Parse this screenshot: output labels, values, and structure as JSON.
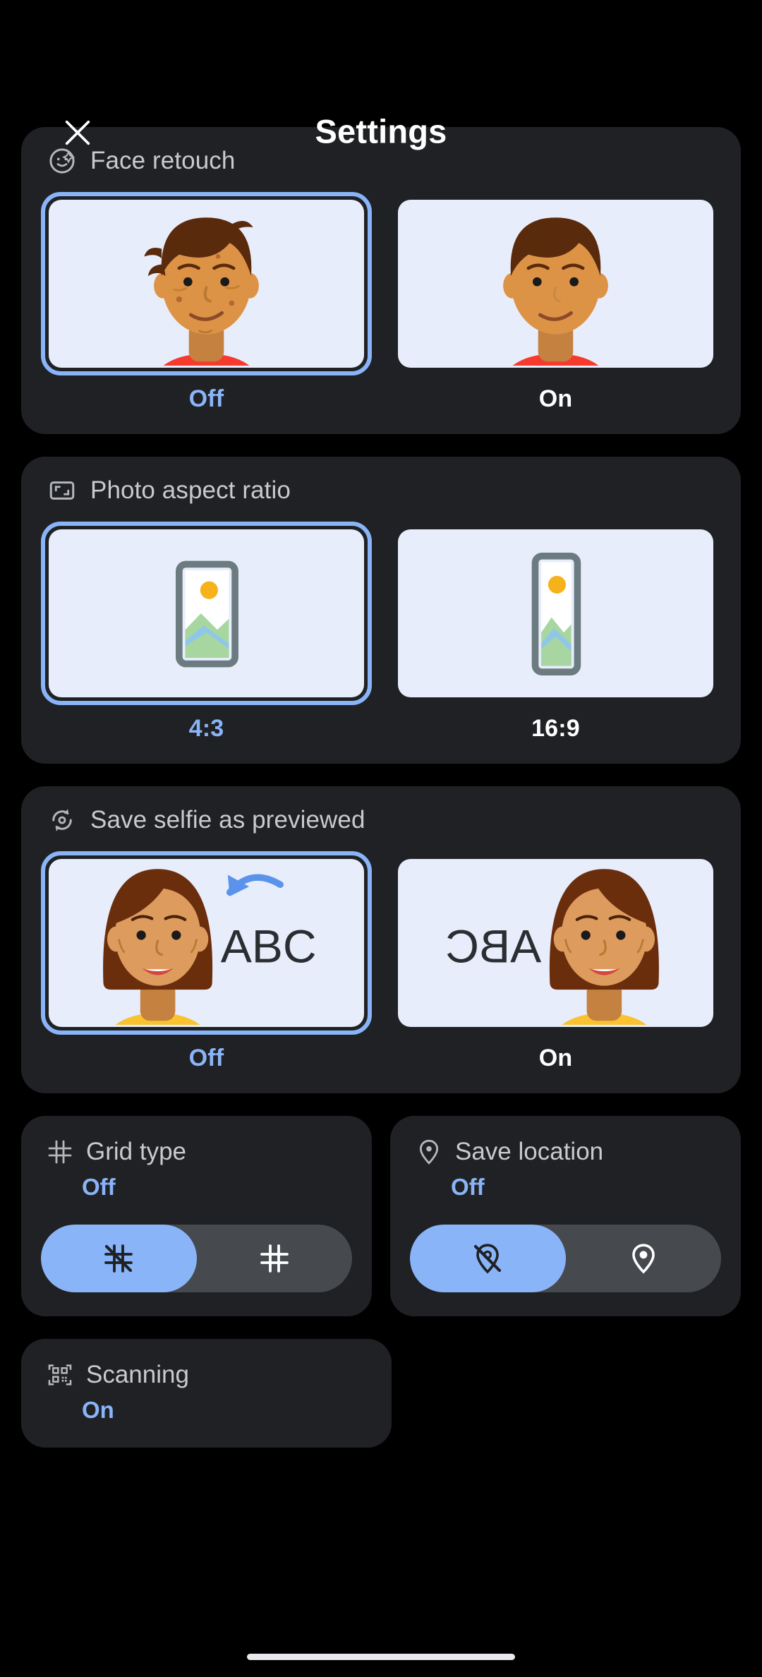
{
  "header": {
    "title": "Settings",
    "close_icon": "close-icon"
  },
  "sections": [
    {
      "id": "face-retouch",
      "title": "Face retouch",
      "icon": "face-retouch-icon",
      "options": [
        {
          "label": "Off",
          "selected": true,
          "illustration": "face-unretouched"
        },
        {
          "label": "On",
          "selected": false,
          "illustration": "face-retouched"
        }
      ]
    },
    {
      "id": "photo-aspect-ratio",
      "title": "Photo aspect ratio",
      "icon": "aspect-ratio-icon",
      "options": [
        {
          "label": "4:3",
          "selected": true,
          "illustration": "photo-4-3"
        },
        {
          "label": "16:9",
          "selected": false,
          "illustration": "photo-16-9"
        }
      ]
    },
    {
      "id": "save-selfie-as-previewed",
      "title": "Save selfie as previewed",
      "icon": "flip-camera-icon",
      "options": [
        {
          "label": "Off",
          "selected": true,
          "illustration": "selfie-normal",
          "sample_text": "ABC"
        },
        {
          "label": "On",
          "selected": false,
          "illustration": "selfie-mirrored",
          "sample_text": "ABC"
        }
      ]
    }
  ],
  "half_cards": [
    {
      "id": "grid-type",
      "title": "Grid type",
      "icon": "grid-icon",
      "value": "Off",
      "segments": [
        {
          "icon": "grid-off-icon",
          "selected": true
        },
        {
          "icon": "grid-on-icon",
          "selected": false
        }
      ]
    },
    {
      "id": "save-location",
      "title": "Save location",
      "icon": "location-pin-icon",
      "value": "Off",
      "segments": [
        {
          "icon": "location-off-icon",
          "selected": true
        },
        {
          "icon": "location-on-icon",
          "selected": false
        }
      ]
    },
    {
      "id": "scanning",
      "title": "Scanning",
      "icon": "qr-code-icon",
      "value": "On",
      "segments": []
    }
  ],
  "colors": {
    "background": "#000000",
    "card": "#1f2124",
    "accent": "#8ab4f8",
    "title_text": "#c8cace",
    "label_text": "#ffffff",
    "thumb_bg": "#e8edfb",
    "segment_track": "#46494d"
  }
}
